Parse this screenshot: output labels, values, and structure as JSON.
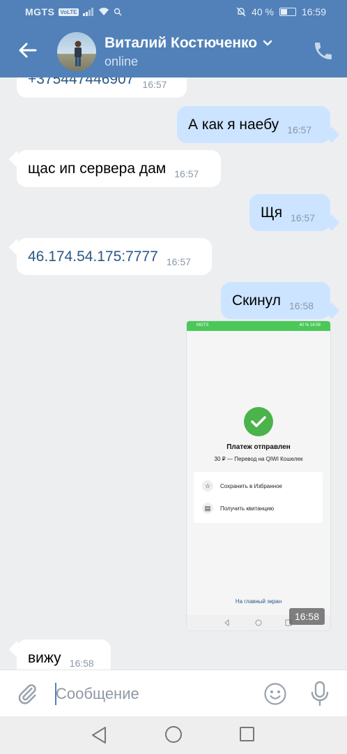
{
  "status_bar": {
    "carrier": "MGTS",
    "volte": "VoLTE",
    "battery": "40 %",
    "battery_level": 0.4,
    "time": "16:59"
  },
  "header": {
    "contact_name": "Виталий Костюченко",
    "status": "online"
  },
  "messages": [
    {
      "dir": "in",
      "text": "+375447446907",
      "time": "16:57",
      "link": true
    },
    {
      "dir": "out",
      "text": "А как я наебу",
      "time": "16:57"
    },
    {
      "dir": "in",
      "text": "щас ип сервера дам",
      "time": "16:57"
    },
    {
      "dir": "out",
      "text": "Щя",
      "time": "16:57"
    },
    {
      "dir": "in",
      "text": "46.174.54.175:7777",
      "time": "16:57",
      "link": true
    },
    {
      "dir": "out",
      "text": "Скинул",
      "time": "16:58"
    },
    {
      "dir": "in",
      "text": "вижу",
      "time": "16:58"
    }
  ],
  "attachment": {
    "time": "16:58",
    "status_carrier": "MGTS",
    "status_right": "40 % 16:58",
    "title": "Платеж отправлен",
    "subtitle": "30 ₽ — Перевод на QIWI Кошелек",
    "actions": [
      "Сохранить в Избранное",
      "Получить квитанцию"
    ],
    "link": "На главный экран"
  },
  "input": {
    "placeholder": "Сообщение"
  },
  "colors": {
    "header": "#5181b8",
    "incoming": "#ffffff",
    "outgoing": "#cce4ff",
    "background": "#edeef0",
    "link": "#2a5885",
    "success": "#4bb34b"
  }
}
